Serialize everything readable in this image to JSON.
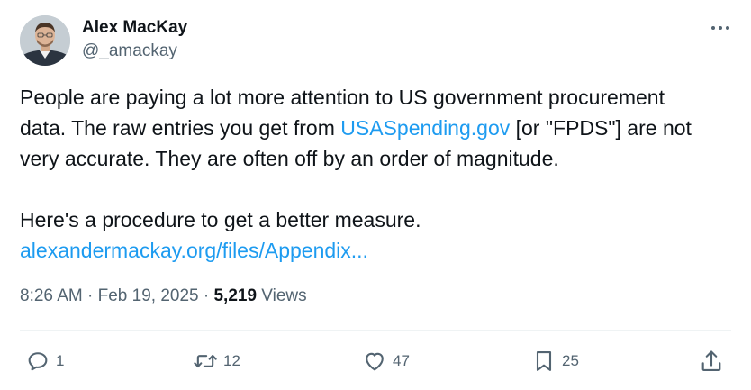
{
  "author": {
    "display_name": "Alex MacKay",
    "handle": "@_amackay",
    "avatar_icon": "profile-photo"
  },
  "tweet": {
    "line1": "People are paying a lot more attention to US government procurement",
    "line2_prefix": "data. The raw entries you get from ",
    "line2_link": "USASpending.gov",
    "line2_suffix": " [or \"FPDS\"] are not",
    "line3": "very accurate. They are often off by an order of magnitude.",
    "line4": "Here's a procedure to get a better measure.",
    "link2": "alexandermackay.org/files/Appendix..."
  },
  "meta": {
    "time": "8:26 AM",
    "separator1": " · ",
    "date": "Feb 19, 2025",
    "separator2": " · ",
    "views_count": "5,219",
    "views_label": " Views"
  },
  "actions": {
    "reply_count": "1",
    "retweet_count": "12",
    "like_count": "47",
    "bookmark_count": "25"
  },
  "colors": {
    "link": "#1d9bf0",
    "secondary_text": "#536471",
    "primary_text": "#0f1419"
  }
}
